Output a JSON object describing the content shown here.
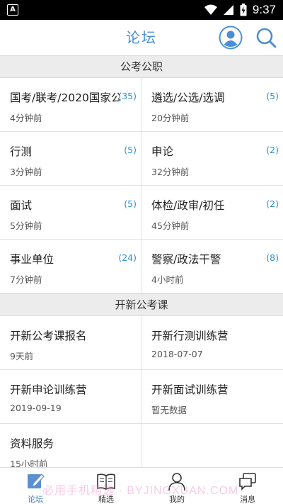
{
  "status": {
    "time": "9:37",
    "app_badge": "A"
  },
  "header": {
    "title": "论坛"
  },
  "sections": [
    {
      "title": "公考公职",
      "items": [
        {
          "name": "国考/联考/2020国家公",
          "count": "(35)",
          "time": "4分钟前"
        },
        {
          "name": "遴选/公选/选调",
          "count": "(5)",
          "time": "20分钟前"
        },
        {
          "name": "行测",
          "count": "(5)",
          "time": "3分钟前"
        },
        {
          "name": "申论",
          "count": "(2)",
          "time": "32分钟前"
        },
        {
          "name": "面试",
          "count": "(5)",
          "time": "5分钟前"
        },
        {
          "name": "体检/政审/初任",
          "count": "(2)",
          "time": "45分钟前"
        },
        {
          "name": "事业单位",
          "count": "(24)",
          "time": "7分钟前"
        },
        {
          "name": "警察/政法干警",
          "count": "(8)",
          "time": "4小时前"
        }
      ]
    },
    {
      "title": "开新公考课",
      "items": [
        {
          "name": "开新公考课报名",
          "count": "",
          "time": "9天前"
        },
        {
          "name": "开新行测训练营",
          "count": "",
          "time": "2018-07-07"
        },
        {
          "name": "开新申论训练营",
          "count": "",
          "time": "2019-09-19"
        },
        {
          "name": "开新面试训练营",
          "count": "",
          "time": "暂无数据"
        },
        {
          "name": "资料服务",
          "count": "",
          "time": "15小时前"
        }
      ]
    }
  ],
  "tabs": [
    {
      "label": "论坛",
      "icon": "forum-icon",
      "active": true
    },
    {
      "label": "精选",
      "icon": "book-icon",
      "active": false
    },
    {
      "label": "我的",
      "icon": "person-icon",
      "active": false
    },
    {
      "label": "消息",
      "icon": "message-icon",
      "active": false
    }
  ],
  "watermark": "必用手机精选 · BYJINGXUAN.COM",
  "colors": {
    "accent": "#4a8fd4",
    "count": "#2b8fd0",
    "section_bg": "#ececec"
  }
}
